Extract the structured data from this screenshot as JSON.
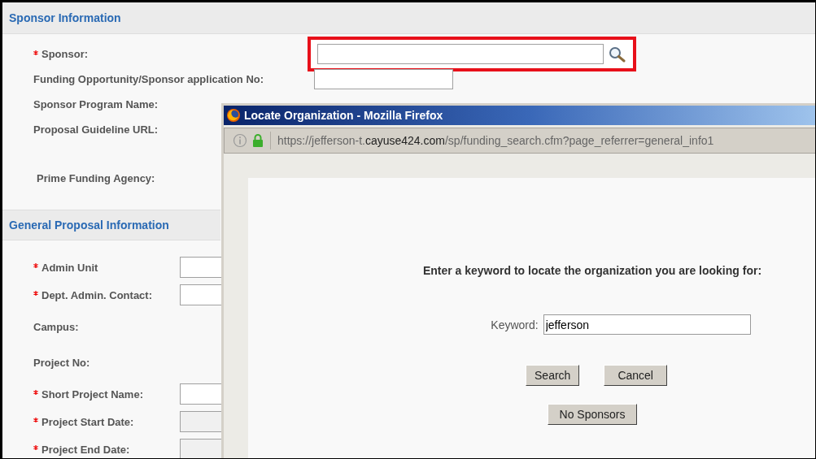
{
  "sponsor_section": {
    "title": "Sponsor Information",
    "fields": [
      {
        "label": "Sponsor:",
        "required": true,
        "kind": "lookup",
        "highlighted": true
      },
      {
        "label": "Funding Opportunity/Sponsor application No:",
        "required": false,
        "kind": "text"
      },
      {
        "label": "Sponsor Program Name:",
        "required": false,
        "kind": "none"
      },
      {
        "label": "Proposal Guideline URL:",
        "required": false,
        "kind": "none"
      },
      {
        "label": "Prime Funding Agency:",
        "required": false,
        "kind": "none"
      }
    ]
  },
  "general_section": {
    "title": "General Proposal Information",
    "fields": [
      {
        "label": "Admin Unit",
        "required": true,
        "kind": "text"
      },
      {
        "label": "Dept. Admin. Contact:",
        "required": true,
        "kind": "text"
      },
      {
        "label": "Campus:",
        "required": false,
        "kind": "none"
      },
      {
        "label": "Project No:",
        "required": false,
        "kind": "none"
      },
      {
        "label": "Short Project Name:",
        "required": true,
        "kind": "text"
      },
      {
        "label": "Project Start Date:",
        "required": true,
        "kind": "disabled"
      },
      {
        "label": "Project End Date:",
        "required": true,
        "kind": "disabled"
      }
    ]
  },
  "popup": {
    "title": "Locate Organization - Mozilla Firefox",
    "url": {
      "prefix": "https://jefferson-t.",
      "domain": "cayuse424.com",
      "suffix": "/sp/funding_search.cfm?page_referrer=general_info1"
    },
    "prompt": "Enter a keyword to locate the organization you are looking for:",
    "keyword_label": "Keyword:",
    "keyword_value": "jefferson",
    "buttons": [
      "Search",
      "Cancel"
    ],
    "bottom_button": "No Sponsors"
  }
}
